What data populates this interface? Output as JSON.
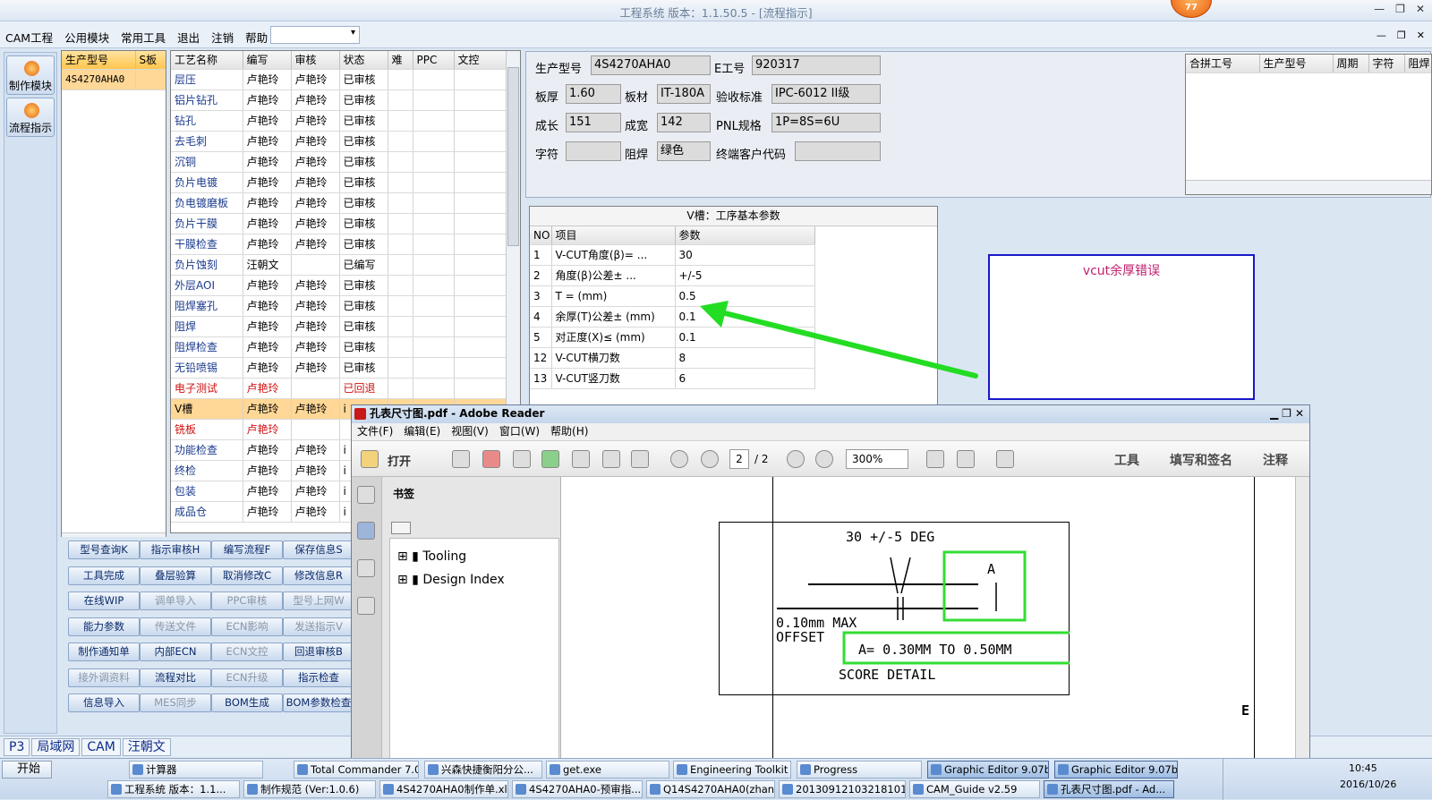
{
  "window": {
    "title": "工程系统  版本：1.1.50.5 - [流程指示]",
    "badge": "77"
  },
  "menu": {
    "items": [
      "CAM工程",
      "公用模块",
      "常用工具",
      "退出",
      "注销",
      "帮助"
    ],
    "help_arrow": "▾",
    "combo_value": ""
  },
  "left_buttons": [
    "制作模块",
    "流程指示"
  ],
  "model_grid": {
    "headers": [
      "生产型号",
      "S板"
    ],
    "rows": [
      [
        "4S4270AHA0",
        ""
      ]
    ]
  },
  "process_grid": {
    "headers": [
      "工艺名称",
      "编写",
      "审核",
      "状态",
      "难",
      "PPC",
      "文控"
    ],
    "rows": [
      [
        "层压",
        "卢艳玲",
        "卢艳玲",
        "已审核"
      ],
      [
        "铝片钻孔",
        "卢艳玲",
        "卢艳玲",
        "已审核"
      ],
      [
        "钻孔",
        "卢艳玲",
        "卢艳玲",
        "已审核"
      ],
      [
        "去毛刺",
        "卢艳玲",
        "卢艳玲",
        "已审核"
      ],
      [
        "沉铜",
        "卢艳玲",
        "卢艳玲",
        "已审核"
      ],
      [
        "负片电镀",
        "卢艳玲",
        "卢艳玲",
        "已审核"
      ],
      [
        "负电镀磨板",
        "卢艳玲",
        "卢艳玲",
        "已审核"
      ],
      [
        "负片干膜",
        "卢艳玲",
        "卢艳玲",
        "已审核"
      ],
      [
        "干膜检查",
        "卢艳玲",
        "卢艳玲",
        "已审核"
      ],
      [
        "负片蚀刻",
        "汪朝文",
        "",
        "已编写"
      ],
      [
        "外层AOI",
        "卢艳玲",
        "卢艳玲",
        "已审核"
      ],
      [
        "阻焊塞孔",
        "卢艳玲",
        "卢艳玲",
        "已审核"
      ],
      [
        "阻焊",
        "卢艳玲",
        "卢艳玲",
        "已审核"
      ],
      [
        "阻焊检查",
        "卢艳玲",
        "卢艳玲",
        "已审核"
      ],
      [
        "无铅喷锡",
        "卢艳玲",
        "卢艳玲",
        "已审核"
      ],
      [
        "电子测试",
        "卢艳玲",
        "",
        "已回退"
      ],
      [
        "V槽",
        "卢艳玲",
        "卢艳玲",
        "i"
      ],
      [
        "铣板",
        "卢艳玲",
        "",
        ""
      ],
      [
        "功能检查",
        "卢艳玲",
        "卢艳玲",
        "i"
      ],
      [
        "终检",
        "卢艳玲",
        "卢艳玲",
        "i"
      ],
      [
        "包装",
        "卢艳玲",
        "卢艳玲",
        "i"
      ],
      [
        "成品仓",
        "卢艳玲",
        "卢艳玲",
        "i"
      ]
    ]
  },
  "func_buttons": [
    [
      "型号查询K",
      "指示审核H",
      "编写流程F",
      "保存信息S"
    ],
    [
      "工具完成",
      "叠层验算",
      "取消修改C",
      "修改信息R"
    ],
    [
      "在线WIP",
      "调单导入",
      "PPC审核",
      "型号上网W"
    ],
    [
      "能力参数",
      "传送文件",
      "ECN影响",
      "发送指示V"
    ],
    [
      "制作通知单",
      "内部ECN",
      "ECN文控",
      "回退审核B"
    ],
    [
      "接外调资料",
      "流程对比",
      "ECN升级",
      "指示检查"
    ],
    [
      "信息导入",
      "MES同步",
      "BOM生成",
      "BOM参数检查"
    ]
  ],
  "status_tabs": [
    "P3",
    "局域网",
    "CAM",
    "汪朝文"
  ],
  "status_arrow": "▾",
  "info": {
    "prod_model_label": "生产型号",
    "prod_model": "4S4270AHA0",
    "e_no_label": "E工号",
    "e_no": "920317",
    "thickness_label": "板厚",
    "thickness": "1.60",
    "material_label": "板材",
    "material": "IT-180A",
    "standard_label": "验收标准",
    "standard": "IPC-6012 II级",
    "len_label": "成长",
    "len": "151",
    "width_label": "成宽",
    "width": "142",
    "pnl_label": "PNL规格",
    "pnl": "1P=8S=6U",
    "char_label": "字符",
    "char": "",
    "mask_label": "阻焊",
    "mask": "绿色",
    "cust_label": "终端客户代码",
    "cust": ""
  },
  "merge_grid": {
    "headers": [
      "合拼工号",
      "生产型号",
      "周期",
      "字符",
      "阻焊"
    ]
  },
  "vgroove": {
    "title": "V槽：工序基本参数",
    "headers": [
      "NO",
      "项目",
      "参数"
    ],
    "rows": [
      [
        "1",
        "V-CUT角度(β)=  ...",
        "30"
      ],
      [
        "2",
        "角度(β)公差±  ...",
        "+/-5"
      ],
      [
        "3",
        "T =  (mm)",
        "0.5"
      ],
      [
        "4",
        "余厚(T)公差±  (mm)",
        "0.1"
      ],
      [
        "5",
        "对正度(X)≤ (mm)",
        "0.1"
      ],
      [
        "12",
        "V-CUT横刀数",
        "8"
      ],
      [
        "13",
        "V-CUT竖刀数",
        "6"
      ]
    ]
  },
  "error_box": "vcut余厚错误",
  "reader": {
    "title": "孔表尺寸图.pdf - Adobe Reader",
    "menu": [
      "文件(F)",
      "编辑(E)",
      "视图(V)",
      "窗口(W)",
      "帮助(H)"
    ],
    "open": "打开",
    "page": "2",
    "pages": "/ 2",
    "zoom": "300%",
    "right_tools": [
      "工具",
      "填写和签名",
      "注释"
    ],
    "bookmarks_title": "书签",
    "bookmarks": [
      "Tooling",
      "Design Index"
    ],
    "drawing": {
      "angle": "30 +/-5 DEG",
      "a": "A",
      "offset1": "0.10mm MAX",
      "offset2": "OFFSET",
      "range": "A= 0.30MM TO 0.50MM",
      "detail": "SCORE DETAIL",
      "side": "E"
    }
  },
  "taskbar": {
    "start": "开始",
    "row1": [
      "计算器",
      "Total Commander 7.0...",
      "兴森快捷衡阳分公...",
      "get.exe",
      "Engineering Toolkit 9....",
      "Progress",
      "Graphic Editor 9.07b...",
      "Graphic Editor 9.07b..."
    ],
    "row2": [
      "工程系统  版本：1.1...",
      "制作规范 (Ver:1.0.6)",
      "4S4270AHA0制作单.xl...",
      "4S4270AHA0-预审指...",
      "Q14S4270AHA0(zhang...",
      "2013091210321810​1.r...",
      "CAM_Guide v2.59",
      "孔表尺寸图.pdf - Ad..."
    ],
    "time": "10:45",
    "date": "2016/10/26"
  },
  "colors": {
    "accent": "#1818c8",
    "arrow": "#22dd22",
    "highlight": "#33dd33",
    "error": "#c0206e"
  }
}
